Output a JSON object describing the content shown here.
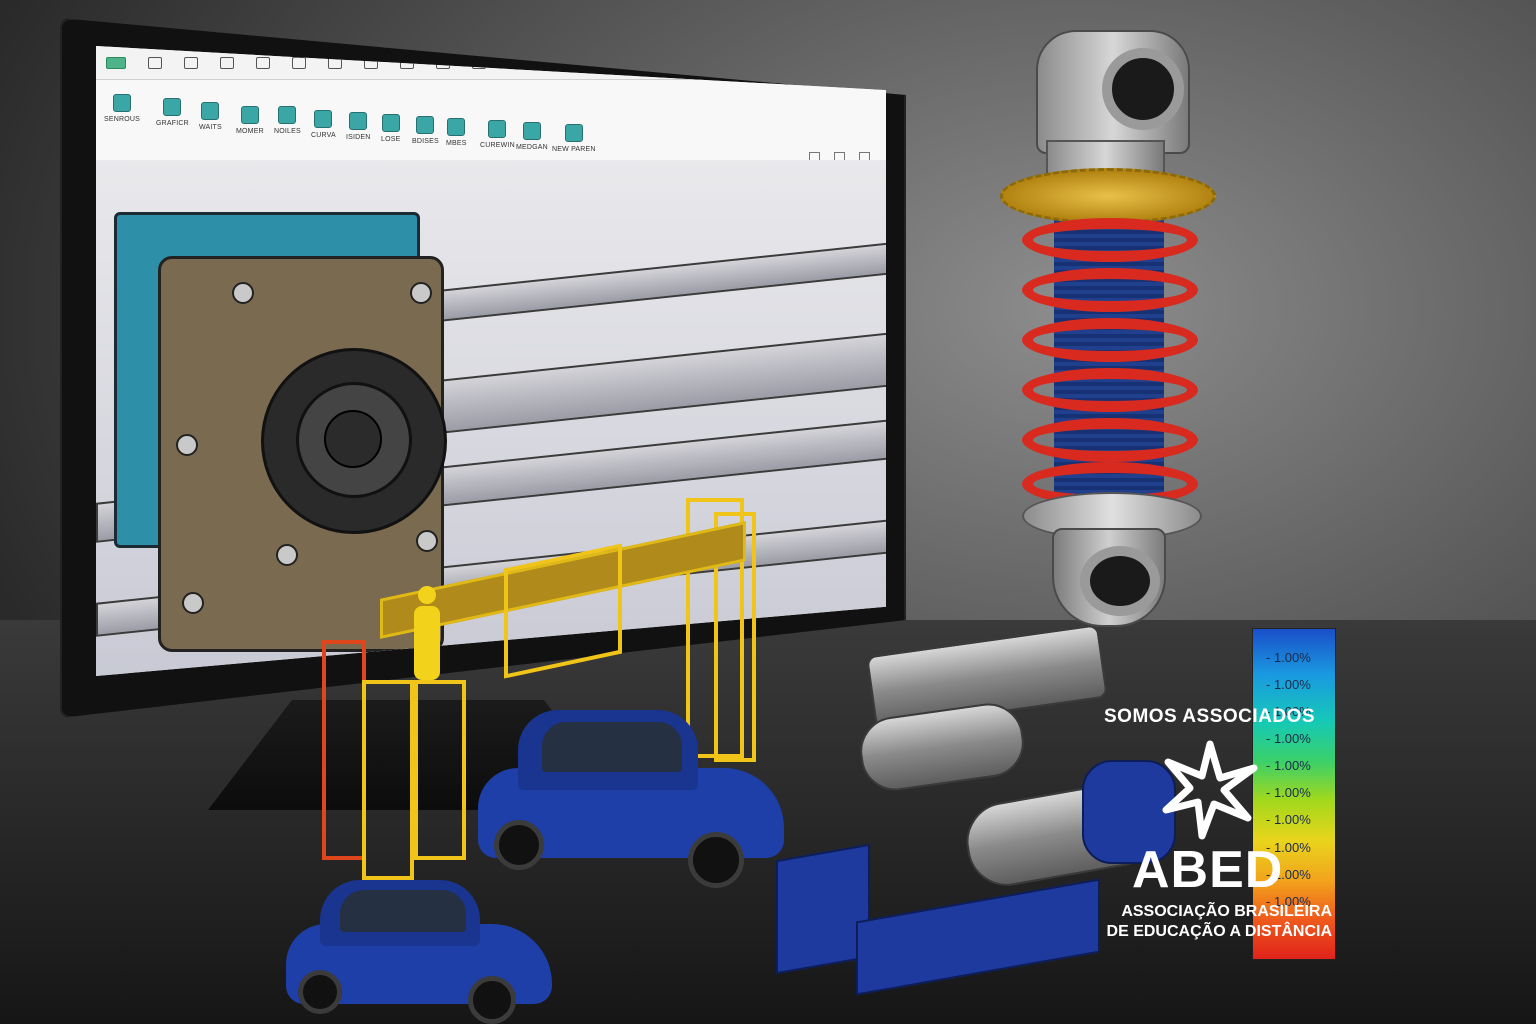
{
  "cad_window": {
    "ribbon_buttons": [
      {
        "label": "SENROUS",
        "icon": "part-icon"
      },
      {
        "label": "GRAFICR",
        "icon": "sketch-icon"
      },
      {
        "label": "WAITS",
        "icon": "feature-icon"
      },
      {
        "label": "MOMER",
        "icon": "model-icon"
      },
      {
        "label": "NOILES",
        "icon": "assembly-icon"
      },
      {
        "label": "CURVA",
        "icon": "curve-icon"
      },
      {
        "label": "ISIDEN",
        "icon": "surface-icon"
      },
      {
        "label": "LOSE",
        "icon": "sheet-icon"
      },
      {
        "label": "BDISES",
        "icon": "weld-icon"
      },
      {
        "label": "MBES",
        "icon": "mold-icon"
      },
      {
        "label": "CUREWIN",
        "icon": "simulation-icon"
      },
      {
        "label": "MEDGAN",
        "icon": "measure-icon"
      },
      {
        "label": "NEW PAREN",
        "icon": "render-icon"
      }
    ],
    "menubar_icons": [
      "logo-icon",
      "zoom-icon",
      "new-icon",
      "open-icon",
      "save-icon",
      "print-icon",
      "undo-icon",
      "redo-icon",
      "select-icon",
      "rebuild-icon",
      "options-icon",
      "grid-icon",
      "view-icon",
      "light-icon",
      "settings-icon",
      "help-icon"
    ],
    "view_tools": [
      "zoom-fit-icon",
      "zoom-area-icon",
      "rotate-icon",
      "section-icon",
      "display-icon",
      "hide-icon",
      "appearance-icon",
      "scene-icon",
      "camera-icon"
    ]
  },
  "stress_scale": {
    "labels": [
      "- 1.00%",
      "- 1.00%",
      "- 1.00%",
      "- 1.00%",
      "- 1.00%",
      "- 1.00%",
      "- 1.00%",
      "- 1.00%",
      "- 1.00%",
      "- 1.00%"
    ],
    "colors": [
      "#1a4fc9",
      "#1a9ae0",
      "#15c9b7",
      "#3ad06a",
      "#a3d81c",
      "#e8d51c",
      "#f2a51c",
      "#ef5a1c",
      "#e0221a"
    ]
  },
  "abed": {
    "tagline": "SOMOS ASSOCIADOS",
    "name": "ABED",
    "subtitle_line1": "ASSOCIAÇÃO BRASILEIRA",
    "subtitle_line2": "DE EDUCAÇÃO A DISTÂNCIA"
  },
  "colors": {
    "car": "#1e3ea8",
    "spring": "#d82a1e",
    "scaffold_red": "#e0461c",
    "scaffold_yellow": "#f0c419",
    "teal_motor": "#2e8fa8"
  }
}
